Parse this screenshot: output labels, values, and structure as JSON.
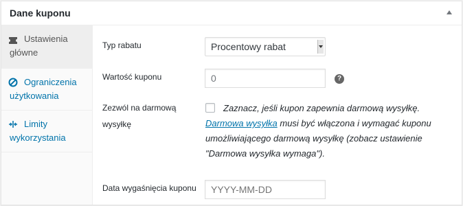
{
  "header": {
    "title": "Dane kuponu"
  },
  "tabs": [
    {
      "line1": "Ustawienia",
      "line2": "główne",
      "icon": "ticket-icon",
      "active": true
    },
    {
      "line1": "Ograniczenia",
      "line2": "użytkowania",
      "icon": "block-icon",
      "active": false
    },
    {
      "line1": "Limity",
      "line2": "wykorzystania",
      "icon": "arrows-icon",
      "active": false
    }
  ],
  "fields": {
    "discount_type": {
      "label": "Typ rabatu",
      "value": "Procentowy rabat"
    },
    "coupon_amount": {
      "label": "Wartość kuponu",
      "value": "0",
      "help": "?"
    },
    "free_shipping": {
      "label_line1": "Zezwól na darmową",
      "label_line2": "wysyłkę",
      "desc_before": "Zaznacz, jeśli kupon zapewnia darmową wysyłkę.",
      "link": "Darmowa wysyłka",
      "desc_after": " musi być włączona i wymagać kuponu umożliwiającego darmową wysyłkę (zobacz ustawienie \"Darmowa wysyłka wymaga\")."
    },
    "expiry_date": {
      "label": "Data wygaśnięcia kuponu",
      "placeholder": "YYYY-MM-DD"
    }
  },
  "colors": {
    "link": "#0073aa",
    "tab_active_bg": "#eeeeee"
  }
}
